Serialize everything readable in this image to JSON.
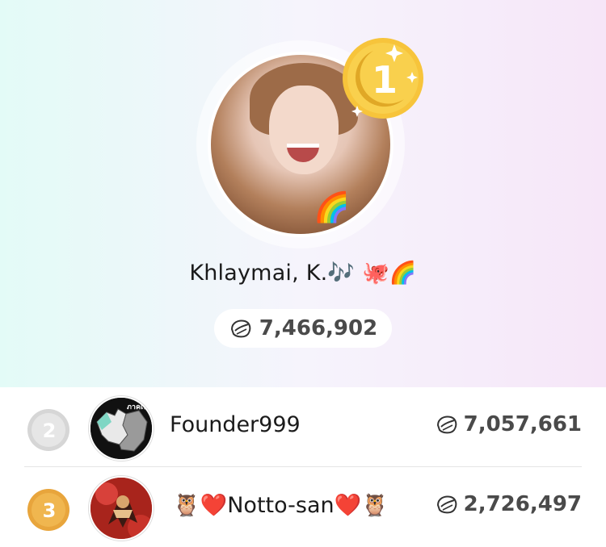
{
  "leader": {
    "rank": "1",
    "name": "Khlaymai, K.",
    "name_emojis": "🎶 🐙🌈",
    "avatar_sticker": "🌈",
    "score": "7,466,902",
    "medal_color": "#f7c43b"
  },
  "rows": [
    {
      "rank": "2",
      "name": "Founder999",
      "score": "7,057,661",
      "medal_color": "#c9c9c9",
      "avatar_caption": "ภาคเห"
    },
    {
      "rank": "3",
      "name": "🦉❤️Notto-san❤️🦉",
      "score": "2,726,497",
      "medal_color": "#e8a53c"
    }
  ],
  "icons": {
    "score_icon": "leaf-coin-icon"
  },
  "colors": {
    "gradient_left": "#e3fbf7",
    "gradient_right": "#f6e6f8",
    "score_text": "#4a4a4a"
  }
}
